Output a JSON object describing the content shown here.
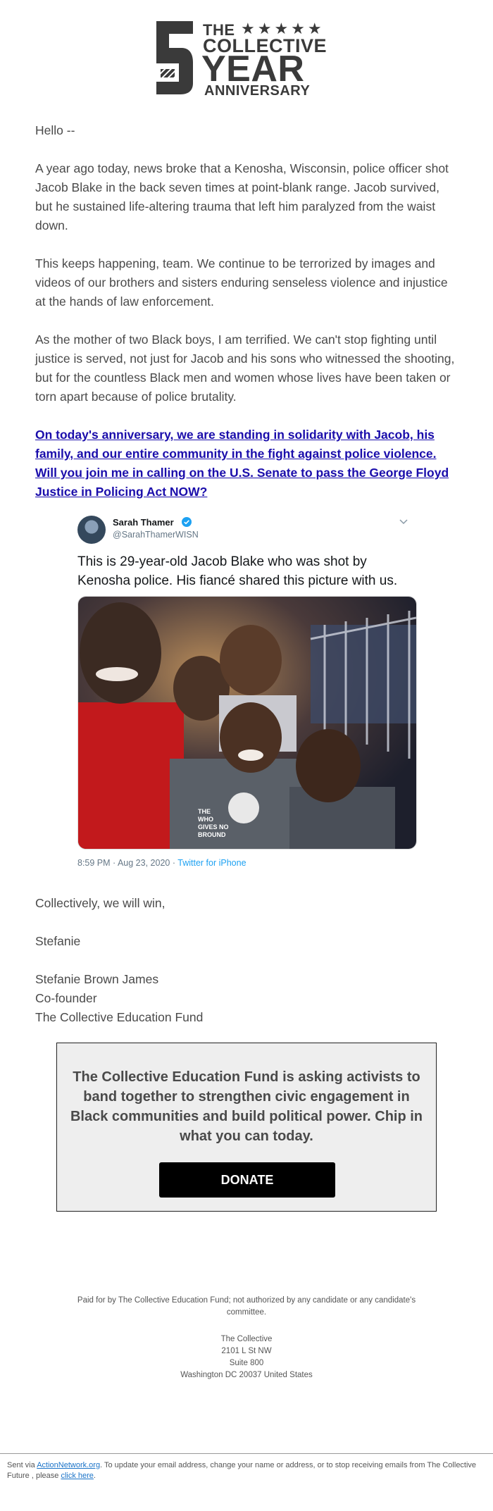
{
  "logo": {
    "the": "THE",
    "stars": "★★★★★",
    "collective": "COLLECTIVE",
    "year": "YEAR",
    "anniversary": "ANNIVERSARY"
  },
  "greeting": "Hello --",
  "paragraphs": [
    "A year ago today, news broke that a Kenosha, Wisconsin, police officer shot Jacob Blake in the back seven times at point-blank range. Jacob survived, but he sustained life-altering trauma that left him paralyzed from the waist down.",
    "This keeps happening, team. We continue to be terrorized by images and videos of our brothers and sisters enduring senseless violence and injustice at the hands of law enforcement.",
    "As the mother of two Black boys, I am terrified. We can't stop fighting until justice is served, not just for Jacob and his sons who witnessed the shooting, but for the countless Black men and women whose lives have been taken or torn apart because of police brutality."
  ],
  "cta_link": "On today's anniversary, we are standing in solidarity with Jacob, his family, and our entire community in the fight against police violence. Will you join me in calling on the U.S. Senate to pass the George Floyd Justice in Policing Act NOW?",
  "tweet": {
    "name": "Sarah Thamer",
    "handle": "@SarahThamerWISN",
    "text": "This is 29-year-old Jacob Blake who was shot by Kenosha police. His fiancé shared this picture with us.",
    "shirt_text": "THE\nWHO\nGIVES NO\nBROUND",
    "time": "8:59 PM · Aug 23, 2020",
    "source": "Twitter for iPhone"
  },
  "signoff": {
    "closing": "Collectively, we will win,",
    "first_name": "Stefanie",
    "full_name": "Stefanie Brown James",
    "title": "Co-founder",
    "org": "The Collective Education Fund"
  },
  "appeal": {
    "text": "The Collective Education Fund is asking activists to band together to strengthen civic engagement in Black communities and build political power. Chip in what you can today.",
    "button": "DONATE"
  },
  "footer": {
    "disclaimer": "Paid for by The Collective Education Fund; not authorized by any candidate or any candidate's committee.",
    "address": [
      "The Collective",
      "2101 L St NW",
      "Suite 800",
      "Washington DC 20037 United States"
    ]
  },
  "bottom": {
    "prefix": "Sent via ",
    "service_link": "ActionNetwork.org",
    "middle": ". To update your email address, change your name or address, or to stop receiving emails from The Collective Future , please ",
    "unsub_link": "click here",
    "suffix": "."
  },
  "colors": {
    "link": "#1a0dab",
    "twitter_blue": "#1da1f2",
    "appeal_bg": "#eeeeee",
    "donate_bg": "#000000"
  }
}
